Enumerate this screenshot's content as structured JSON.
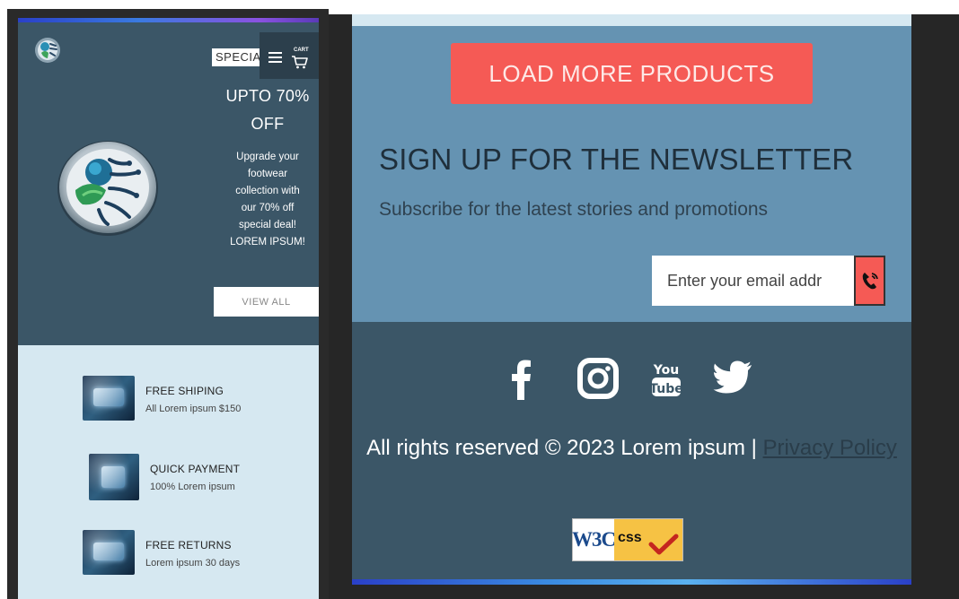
{
  "header": {
    "special_label": "SPECIAL",
    "cart_label": "CART"
  },
  "hero": {
    "title_line1": "UPTO 70%",
    "title_line2": "OFF",
    "description": "Upgrade your footwear collection with our 70% off special deal! LOREM IPSUM!",
    "cta_label": "VIEW ALL"
  },
  "features": [
    {
      "title": "FREE SHIPING",
      "subtitle": "All Lorem ipsum $150"
    },
    {
      "title": "QUICK PAYMENT",
      "subtitle": "100% Lorem ipsum"
    },
    {
      "title": "FREE RETURNS",
      "subtitle": "Lorem ipsum 30 days"
    }
  ],
  "newsletter": {
    "load_more_label": "LOAD MORE PRODUCTS",
    "title": "SIGN UP FOR THE NEWSLETTER",
    "subtitle": "Subscribe for the latest stories and promotions",
    "email_placeholder": "Enter your email addr"
  },
  "footer": {
    "social": [
      "facebook-icon",
      "instagram-icon",
      "youtube-icon",
      "twitter-icon"
    ],
    "copyright_text": "All rights reserved © 2023 Lorem ipsum | ",
    "privacy_link": "Privacy Policy",
    "w3c_label": "W3C",
    "css_label": "css"
  },
  "colors": {
    "panel_dark": "#3b5667",
    "panel_mid": "#6593b2",
    "panel_light": "#d6e8f1",
    "accent": "#f55a55"
  }
}
